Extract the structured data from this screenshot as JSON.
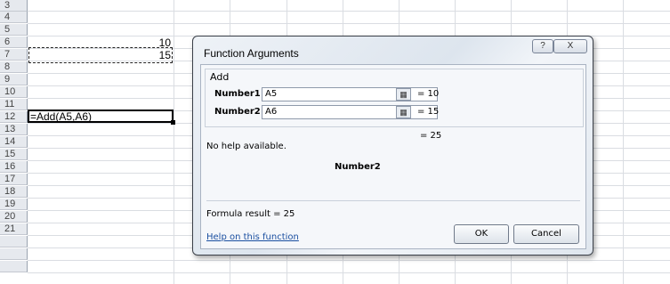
{
  "rows": [
    "3",
    "4",
    "5",
    "6",
    "7",
    "8",
    "9",
    "10",
    "11",
    "12",
    "13",
    "14",
    "15",
    "16",
    "17",
    "18",
    "19",
    "20",
    "21"
  ],
  "cells": {
    "a5_value": "10",
    "a6_value": "15",
    "a10_formula": "=Add(A5,A6)"
  },
  "dialog": {
    "title": "Function Arguments",
    "help_icon": "?",
    "close_icon": "X",
    "function_name": "Add",
    "args": [
      {
        "label": "Number1",
        "value": "A5",
        "result": "=  10"
      },
      {
        "label": "Number2",
        "value": "A6",
        "result": "=  15"
      }
    ],
    "total": "=  25",
    "help_text": "No help available.",
    "arg_description": "Number2",
    "formula_result": "Formula result =  25",
    "help_link": "Help on this function",
    "ok_label": "OK",
    "cancel_label": "Cancel"
  }
}
